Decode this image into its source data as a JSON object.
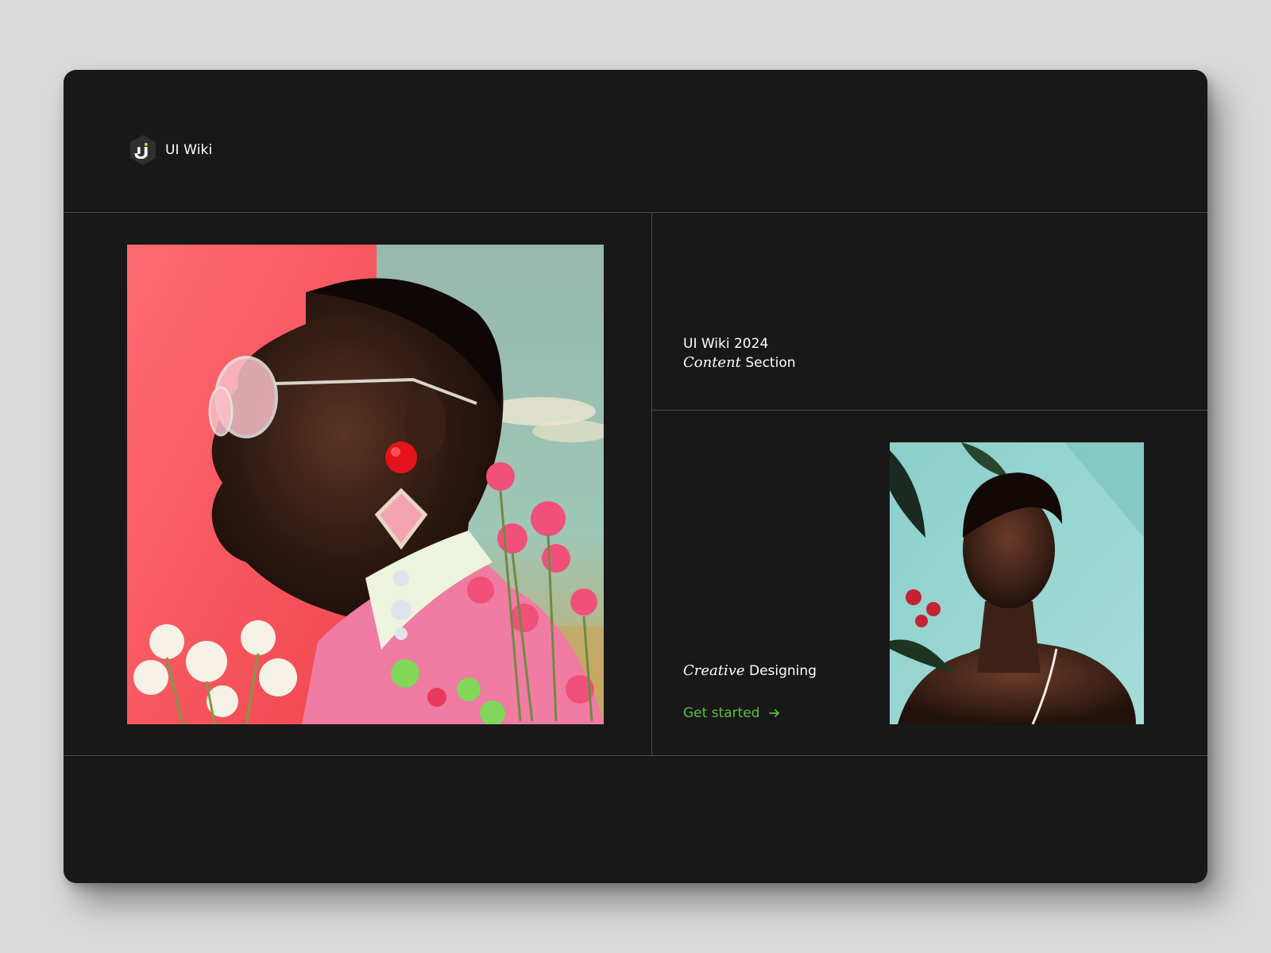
{
  "brand": {
    "logo_letter": "ui",
    "name": "UI Wiki"
  },
  "hero": {
    "title_line1": "UI Wiki 2024",
    "title_italic": "Content",
    "title_rest": "Section"
  },
  "feature": {
    "label_italic": "Creative",
    "label_rest": "Designing",
    "cta_label": "Get started"
  },
  "colors": {
    "page_background": "#dadada",
    "card_background": "#181818",
    "divider": "#4a4a4a",
    "accent_green": "#5cbe3f",
    "text": "#ffffff"
  },
  "icons": {
    "logo": "ui-hexagon-logo-icon",
    "cta": "arrow-right-icon"
  },
  "images": {
    "main": "portrait-woman-pink-earrings-sunglasses-photo",
    "secondary": "portrait-woman-teal-wall-photo"
  }
}
